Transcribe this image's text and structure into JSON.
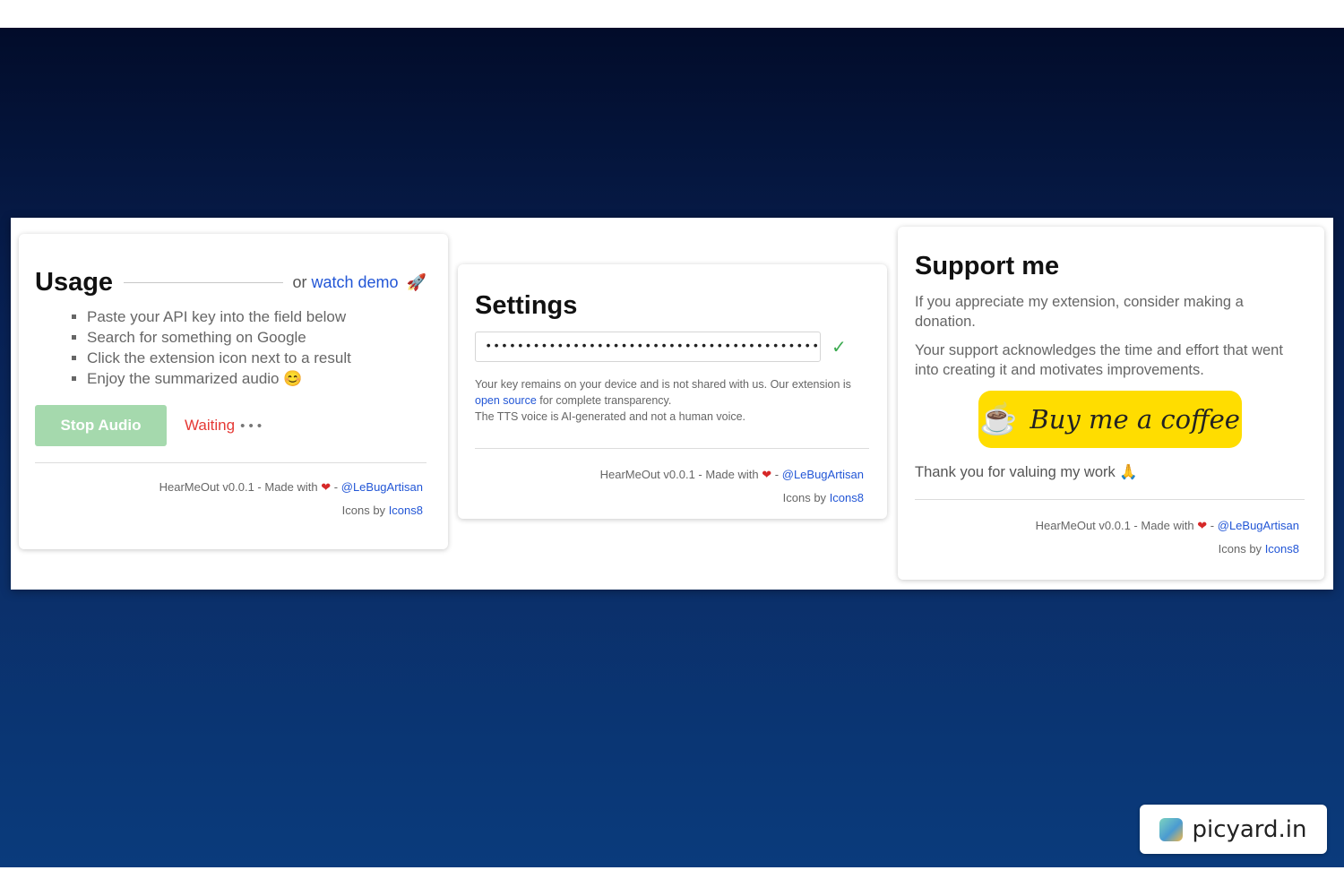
{
  "usage": {
    "title": "Usage",
    "demo_prefix": "or",
    "demo_link": "watch demo",
    "demo_icon": "🚀",
    "steps": [
      "Paste your API key into the field below",
      "Search for something on Google",
      "Click the extension icon next to a result",
      "Enjoy the summarized audio 😊"
    ],
    "stop_button": "Stop Audio",
    "status": "Waiting",
    "status_dots": "• • •"
  },
  "settings": {
    "title": "Settings",
    "api_key_value": "•••••••••••••••••••••••••••••••••••••••••••••••",
    "note_1a": "Your key remains on your device and is not shared with us. Our extension is ",
    "note_link": "open source",
    "note_1b": " for complete transparency.",
    "note_2": "The TTS voice is AI-generated and not a human voice."
  },
  "support": {
    "title": "Support me",
    "p1": "If you appreciate my extension, consider making a donation.",
    "p2": "Your support acknowledges the time and effort that went into creating it and motivates improvements.",
    "coffee_icon": "☕",
    "coffee_label": "Buy me a coffee",
    "thanks": "Thank you for valuing my work 🙏"
  },
  "footer": {
    "made_with": "HearMeOut v0.0.1 - Made with",
    "heart": "❤",
    "separator": "-",
    "author": "@LeBugArtisan",
    "icons_by": "Icons by",
    "icons_link": "Icons8"
  },
  "watermark": {
    "text": "picyard.in"
  }
}
